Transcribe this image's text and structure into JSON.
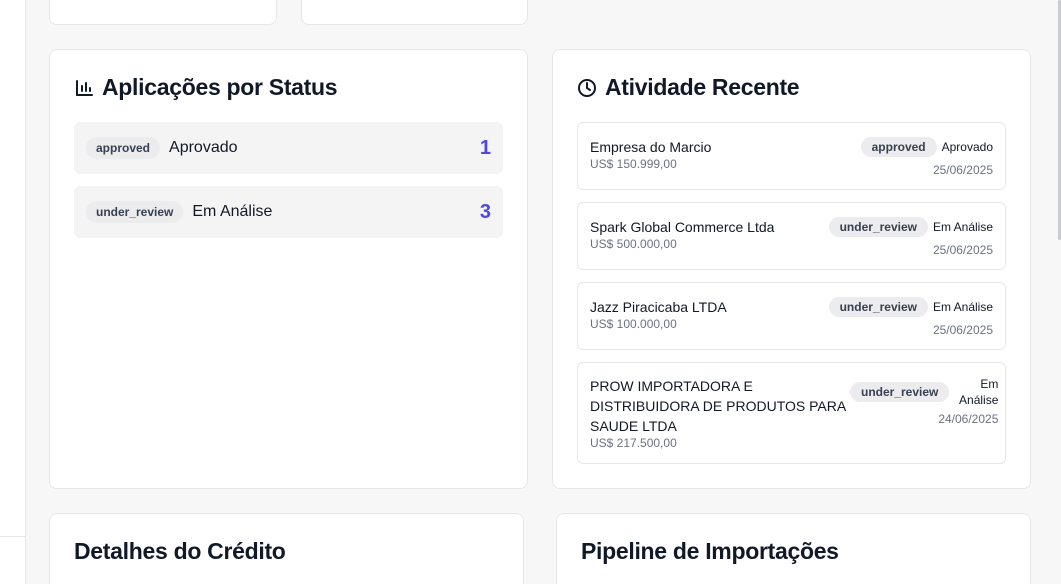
{
  "status_section": {
    "title": "Aplicações por Status",
    "icon": "bar-chart-icon",
    "rows": [
      {
        "badge": "approved",
        "label": "Aprovado",
        "count": "1"
      },
      {
        "badge": "under_review",
        "label": "Em Análise",
        "count": "3"
      }
    ]
  },
  "activity_section": {
    "title": "Atividade Recente",
    "icon": "clock-icon",
    "items": [
      {
        "company": "Empresa do Marcio",
        "amount": "US$ 150.999,00",
        "badge": "approved",
        "status": "Aprovado",
        "date": "25/06/2025"
      },
      {
        "company": "Spark Global Commerce Ltda",
        "amount": "US$ 500.000,00",
        "badge": "under_review",
        "status": "Em Análise",
        "date": "25/06/2025"
      },
      {
        "company": "Jazz Piracicaba LTDA",
        "amount": "US$ 100.000,00",
        "badge": "under_review",
        "status": "Em Análise",
        "date": "25/06/2025"
      },
      {
        "company": "PROW IMPORTADORA E DISTRIBUIDORA DE PRODUTOS PARA SAUDE LTDA",
        "amount": "US$ 217.500,00",
        "badge": "under_review",
        "status": "Em Análise",
        "date": "24/06/2025"
      }
    ]
  },
  "credit_section": {
    "title": "Detalhes do Crédito"
  },
  "pipeline_section": {
    "title": "Pipeline de Importações"
  },
  "colors": {
    "accent": "#4f46e5",
    "badge_bg": "#ececee",
    "row_bg": "#f4f4f5"
  }
}
